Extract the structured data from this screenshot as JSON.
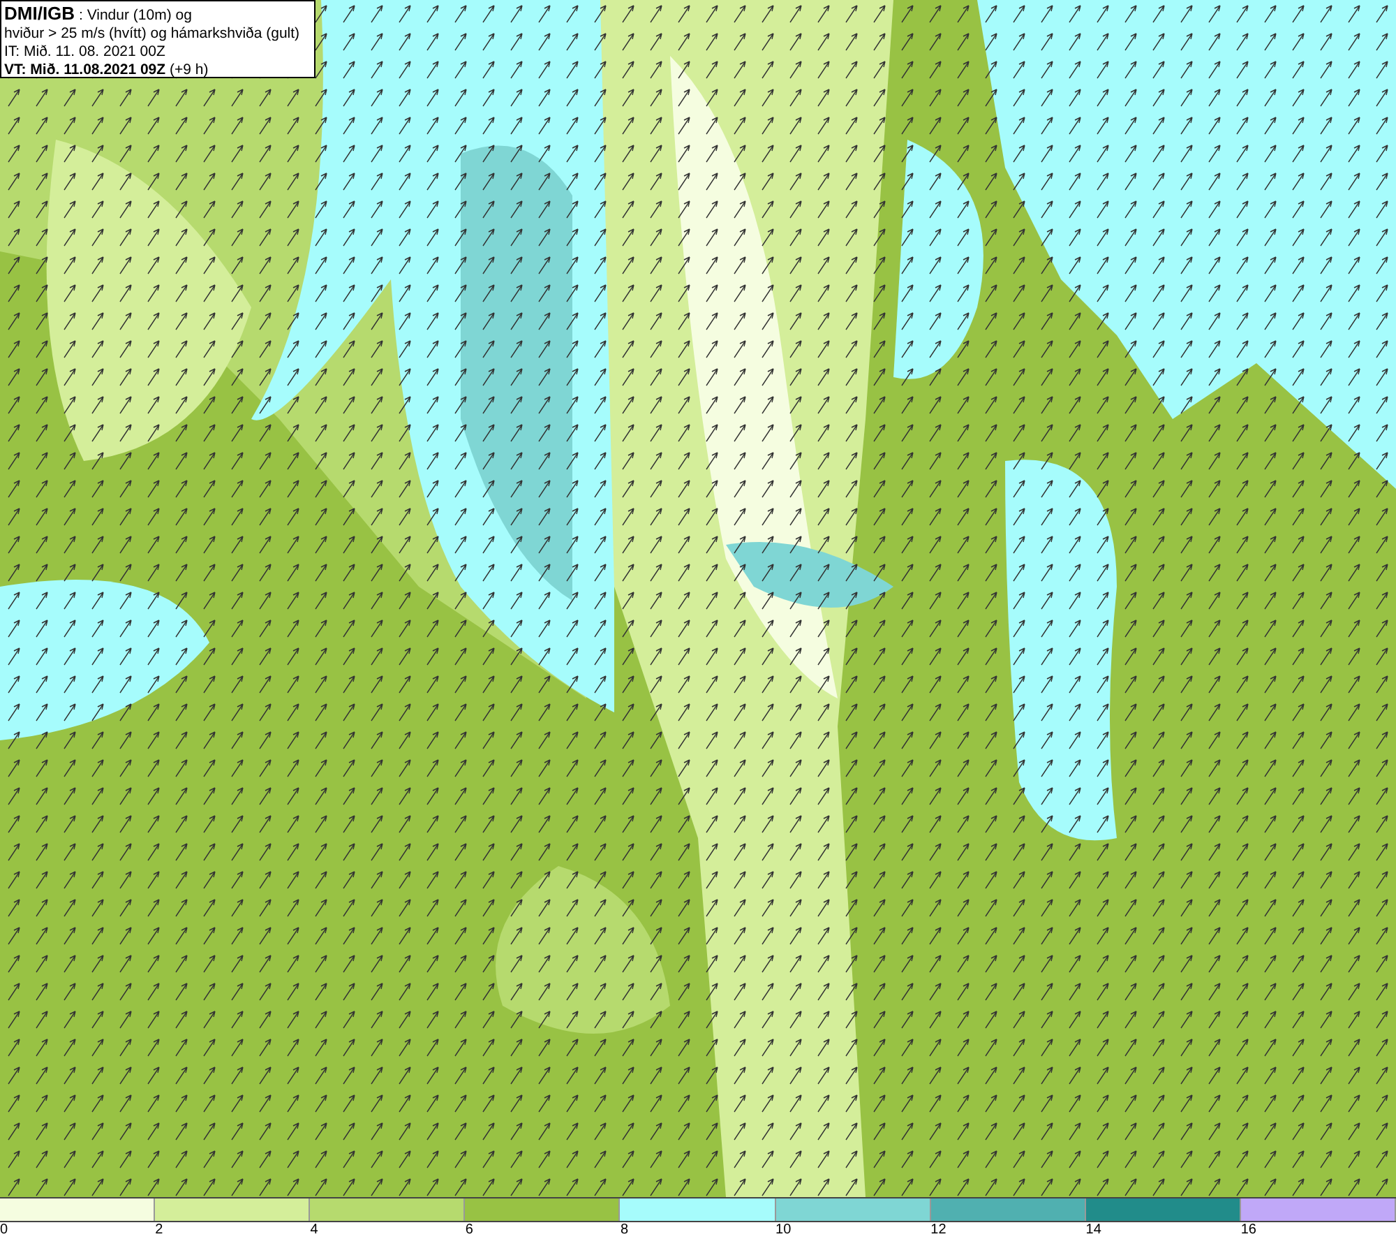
{
  "title_box": {
    "lines": [
      "**DMI/IGB** : Vindur (10m) og",
      "hviður > 25 m/s (hvítt) og hámarkshviða (gult)",
      "IT: Mið. 11. 08. 2021 00Z",
      "**VT: Mið. 11.08.2021 09Z** (+9 h)"
    ]
  },
  "legend": {
    "bins": [
      {
        "color": "#f5fde0"
      },
      {
        "color": "#d4ee9a"
      },
      {
        "color": "#b6da6e"
      },
      {
        "color": "#98c244"
      },
      {
        "color": "#a6fcfc"
      },
      {
        "color": "#7fd6d4"
      },
      {
        "color": "#50b0b0"
      },
      {
        "color": "#218c8a"
      },
      {
        "color": "#c0a8f8"
      }
    ],
    "ticks": [
      "0",
      "2",
      "4",
      "6",
      "8",
      "10",
      "12",
      "14",
      "16"
    ]
  }
}
